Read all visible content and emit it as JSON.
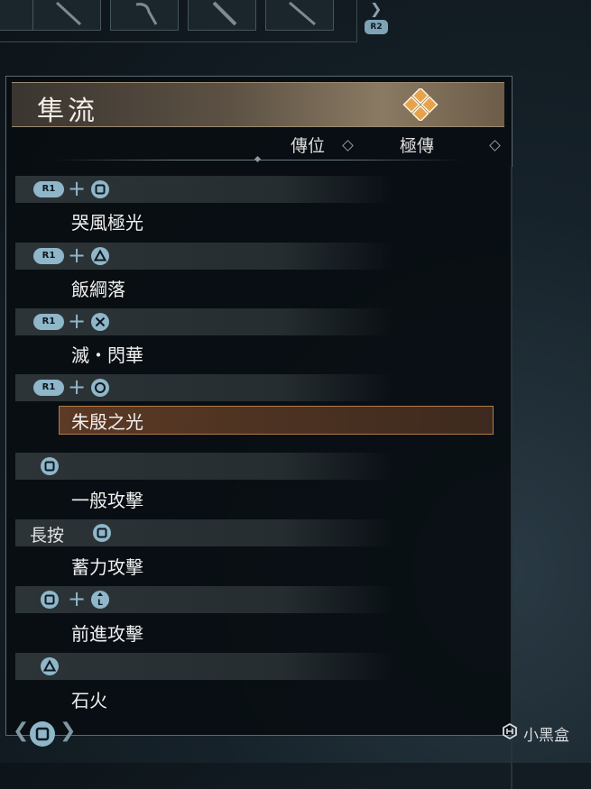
{
  "top_bar": {
    "r2_label": "R2"
  },
  "panel": {
    "title": "隼流",
    "columns": [
      "傳位",
      "極傳"
    ]
  },
  "moves": [
    {
      "inputs": [
        "R1",
        "+",
        "square"
      ],
      "name": "哭風極光",
      "selected": false
    },
    {
      "inputs": [
        "R1",
        "+",
        "triangle"
      ],
      "name": "飯綱落",
      "selected": false
    },
    {
      "inputs": [
        "R1",
        "+",
        "cross"
      ],
      "name": "滅・閃華",
      "selected": false
    },
    {
      "inputs": [
        "R1",
        "+",
        "circle"
      ],
      "name": "朱殷之光",
      "selected": true
    },
    {
      "inputs": [
        "square"
      ],
      "name": "一般攻擊",
      "selected": false
    },
    {
      "inputs": [
        "長按",
        "square"
      ],
      "name": "蓄力攻擊",
      "selected": false
    },
    {
      "inputs": [
        "square",
        "+",
        "L-stick-up"
      ],
      "name": "前進攻擊",
      "selected": false
    },
    {
      "inputs": [
        "triangle"
      ],
      "name": "石火",
      "selected": false
    }
  ],
  "labels": {
    "r1": "R1",
    "hold": "長按",
    "plus": "+"
  },
  "watermark": "小黑盒",
  "colors": {
    "button_accent": "#8fb6c9",
    "selection": "#5c3a25",
    "selection_border": "#b37a48"
  }
}
